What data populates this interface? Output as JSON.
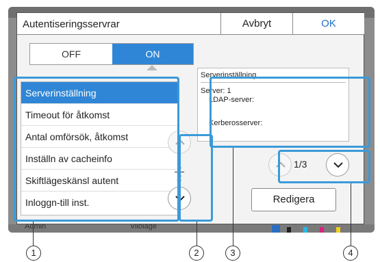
{
  "background": {
    "user_label": "Admin",
    "mode_label": "Viloläge",
    "ink_letters": [
      "K",
      "C",
      "M",
      "Y"
    ]
  },
  "dialog": {
    "title": "Autentiseringsservrar",
    "cancel_label": "Avbryt",
    "ok_label": "OK"
  },
  "toggle": {
    "off_label": "OFF",
    "on_label": "ON",
    "selected": "ON"
  },
  "menu": {
    "items": [
      {
        "label": "Serverinställning",
        "selected": true
      },
      {
        "label": "Timeout för åtkomst"
      },
      {
        "label": "Antal omförsök, åtkomst"
      },
      {
        "label": "Inställn av cacheinfo"
      },
      {
        "label": "Skiftlägeskänsl autent"
      },
      {
        "label": "Inloggn-till inst."
      }
    ],
    "page_current": "1",
    "page_total": "2"
  },
  "details": {
    "heading": "Serverinställning",
    "server_line": "Server: 1",
    "ldap_label": "LDAP-server:",
    "kerberos_label": "Kerberosserver:",
    "page_indicator": "1/3"
  },
  "edit_label": "Redigera",
  "callouts": [
    "1",
    "2",
    "3",
    "4"
  ],
  "colors": {
    "accent": "#2f86d6",
    "callout": "#3a9ad9",
    "ok_text": "#1f6fc6"
  },
  "icons": {
    "up": "chevron-up-icon",
    "down": "chevron-down-icon"
  }
}
